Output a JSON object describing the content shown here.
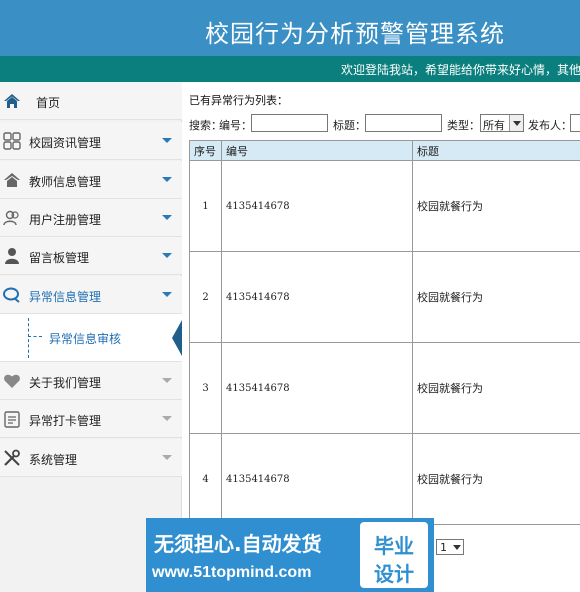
{
  "header": {
    "title": "校园行为分析预警管理系统",
    "welcome": "欢迎登陆我站，希望能给你带来好心情，其他"
  },
  "sidebar": {
    "items": [
      {
        "label": "首页",
        "icon": "home-icon"
      },
      {
        "label": "校园资讯管理",
        "icon": "grid-icon"
      },
      {
        "label": "教师信息管理",
        "icon": "house-icon"
      },
      {
        "label": "用户注册管理",
        "icon": "users-icon"
      },
      {
        "label": "留言板管理",
        "icon": "user-icon"
      },
      {
        "label": "异常信息管理",
        "icon": "chat-icon"
      },
      {
        "label": "关于我们管理",
        "icon": "heart-icon"
      },
      {
        "label": "异常打卡管理",
        "icon": "clipboard-icon"
      },
      {
        "label": "系统管理",
        "icon": "tools-icon"
      }
    ],
    "submenu": {
      "label": "异常信息审核"
    }
  },
  "main": {
    "list_title": "已有异常行为列表：",
    "search": {
      "label": "搜索：",
      "code_label": "编号：",
      "title_label": "标题：",
      "type_label": "类型：",
      "type_value": "所有",
      "publisher_label": "发布人："
    },
    "table": {
      "headers": [
        "序号",
        "编号",
        "标题"
      ],
      "rows": [
        {
          "num": "1",
          "code": "4135414678",
          "title": "校园就餐行为"
        },
        {
          "num": "2",
          "code": "4135414678",
          "title": "校园就餐行为"
        },
        {
          "num": "3",
          "code": "4135414678",
          "title": "校园就餐行为"
        },
        {
          "num": "4",
          "code": "4135414678",
          "title": "校园就餐行为"
        }
      ]
    },
    "pager": {
      "value": "1"
    }
  },
  "watermark": {
    "line1": "无须担心.自动发货",
    "line2": "www.51topmind.com",
    "badge_top": "毕业",
    "badge_bottom": "设计"
  },
  "colors": {
    "header": "#3a8fc4",
    "subbar": "#0a7f7d",
    "accent": "#1f6fb2",
    "table_header": "#d6eaf5"
  }
}
